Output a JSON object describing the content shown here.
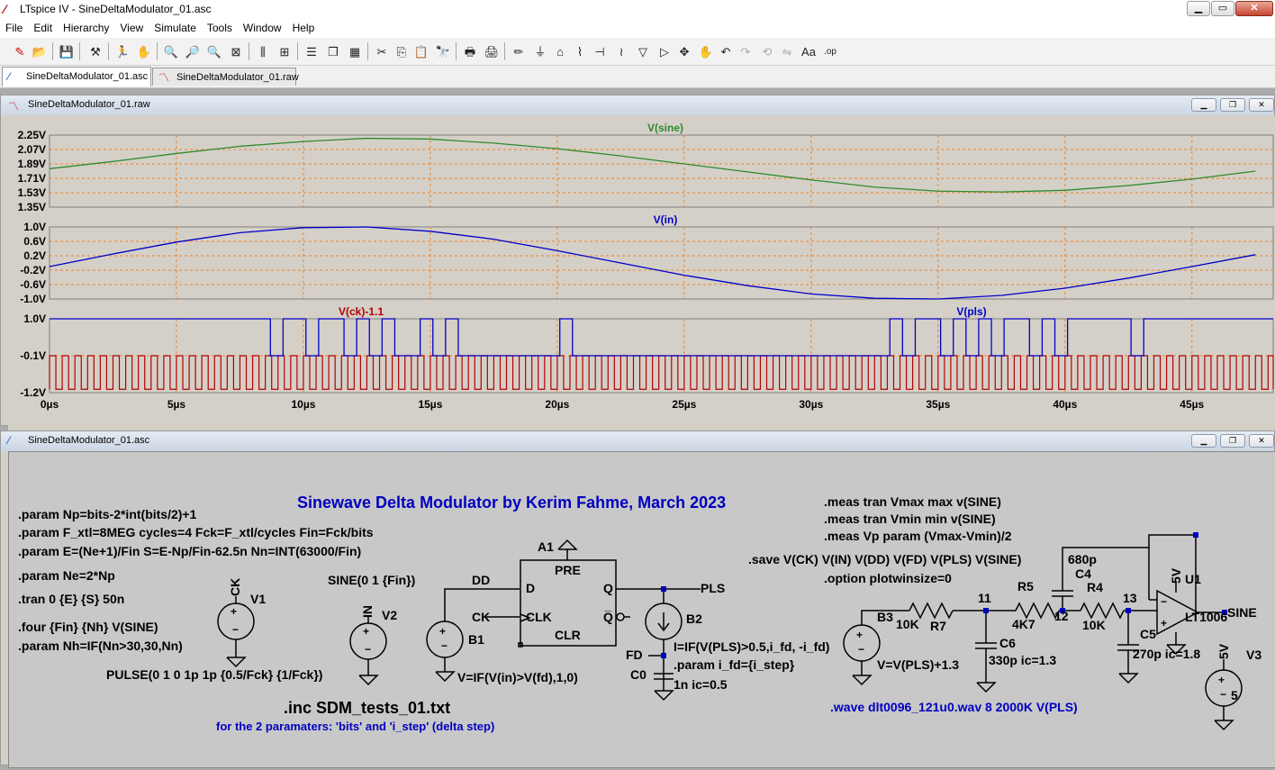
{
  "window": {
    "app_title": "LTspice IV - SineDeltaModulator_01.asc",
    "btn_min": "▁",
    "btn_max": "▭",
    "btn_close": "✕"
  },
  "menu": [
    "File",
    "Edit",
    "Hierarchy",
    "View",
    "Simulate",
    "Tools",
    "Window",
    "Help"
  ],
  "tabs": [
    {
      "label": "SineDeltaModulator_01.asc"
    },
    {
      "label": "SineDeltaModulator_01.raw"
    }
  ],
  "colors": {
    "green": "#2e8b2e",
    "blue": "#0000c8",
    "red": "#b40000",
    "grid": "#f08020"
  },
  "plot_window": {
    "title": "SineDeltaModulator_01.raw"
  },
  "schematic_window": {
    "title": "SineDeltaModulator_01.asc"
  },
  "chart_data": [
    {
      "type": "line",
      "series": [
        {
          "name": "V(sine)",
          "x": [
            0,
            2.5,
            5,
            7.5,
            10,
            12.5,
            15,
            17.5,
            20,
            22.5,
            25,
            27.5,
            30,
            32.5,
            35,
            37.5,
            40,
            42.5,
            45,
            47.5
          ],
          "values": [
            1.83,
            1.92,
            2.02,
            2.11,
            2.17,
            2.21,
            2.2,
            2.15,
            2.08,
            1.99,
            1.89,
            1.79,
            1.69,
            1.6,
            1.55,
            1.54,
            1.56,
            1.62,
            1.7,
            1.8
          ]
        }
      ],
      "yticks": [
        "2.25V",
        "2.07V",
        "1.89V",
        "1.71V",
        "1.53V",
        "1.35V"
      ],
      "ylim": [
        1.35,
        2.25
      ],
      "xlim": [
        0,
        48.2
      ]
    },
    {
      "type": "line",
      "series": [
        {
          "name": "V(in)",
          "x": [
            0,
            2.5,
            5,
            7.5,
            10,
            12.5,
            15,
            17.5,
            20,
            22.5,
            25,
            27.5,
            30,
            32.5,
            35,
            37.5,
            40,
            42.5,
            45,
            47.5
          ],
          "values": [
            -0.1,
            0.25,
            0.58,
            0.84,
            0.98,
            1.0,
            0.88,
            0.66,
            0.34,
            0.0,
            -0.34,
            -0.63,
            -0.86,
            -0.98,
            -1.0,
            -0.9,
            -0.7,
            -0.42,
            -0.1,
            0.23
          ]
        }
      ],
      "yticks": [
        "1.0V",
        "0.6V",
        "0.2V",
        "-0.2V",
        "-0.6V",
        "-1.0V"
      ],
      "ylim": [
        -1.0,
        1.0
      ],
      "xlim": [
        0,
        48.2
      ]
    },
    {
      "type": "line",
      "series": [
        {
          "name": "V(ck)-1.1",
          "period_us": 0.5,
          "high": -0.1,
          "low": -1.1
        },
        {
          "name": "V(pls)",
          "high": 1.0,
          "low": -0.1,
          "low_intervals_us": [
            [
              8.7,
              9.2
            ],
            [
              10.1,
              10.6
            ],
            [
              11.6,
              12.1
            ],
            [
              12.6,
              13.1
            ],
            [
              13.6,
              14.6
            ],
            [
              15.1,
              15.6
            ],
            [
              16.1,
              20.1
            ],
            [
              20.6,
              33.1
            ],
            [
              33.6,
              34.1
            ],
            [
              35.1,
              35.6
            ],
            [
              36.1,
              36.6
            ],
            [
              37.1,
              37.6
            ],
            [
              38.6,
              39.1
            ],
            [
              39.6,
              40.1
            ],
            [
              42.6,
              43.1
            ]
          ]
        }
      ],
      "yticks": [
        "1.0V",
        "-0.1V",
        "-1.2V"
      ],
      "ylim": [
        -1.2,
        1.0
      ],
      "xlim": [
        0,
        48.2
      ],
      "xticks": [
        "0µs",
        "5µs",
        "10µs",
        "15µs",
        "20µs",
        "25µs",
        "30µs",
        "35µs",
        "40µs",
        "45µs"
      ]
    }
  ],
  "schematic": {
    "title": "Sinewave Delta Modulator by Kerim Fahme, March 2023",
    "directives_left": [
      ".param Np=bits-2*int(bits/2)+1",
      ".param F_xtl=8MEG cycles=4 Fck=F_xtl/cycles Fin=Fck/bits",
      ".param E=(Ne+1)/Fin S=E-Np/Fin-62.5n Nn=INT(63000/Fin)",
      ".param Ne=2*Np",
      ".tran 0 {E} {S} 50n",
      ".four {Fin} {Nh} V(SINE)",
      ".param Nh=IF(Nn>30,30,Nn)"
    ],
    "pulse": "PULSE(0 1 0 1p 1p {0.5/Fck} {1/Fck})",
    "sine_src": "SINE(0 1 {Fin})",
    "inc": ".inc SDM_tests_01.txt",
    "inc_note": "for the 2 paramaters: 'bits' and 'i_step' (delta step)",
    "meas": [
      ".meas tran Vmax max v(SINE)",
      ".meas tran Vmin min v(SINE)",
      ".meas Vp param (Vmax-Vmin)/2"
    ],
    "save": ".save V(CK) V(IN) V(DD) V(FD) V(PLS) V(SINE)",
    "option": ".option plotwinsize=0",
    "wave": ".wave dlt0096_121u0.wav 8 2000K V(PLS)",
    "labels": {
      "ck": "CK",
      "v1": "V1",
      "in": "IN",
      "v2": "V2",
      "dd": "DD",
      "ck2": "CK",
      "b1": "B1",
      "b1expr": "V=IF(V(in)>V(fd),1,0)",
      "a1": "A1",
      "pre": "PRE",
      "d": "D",
      "clk": "CLK",
      "clr": "CLR",
      "q": "Q",
      "qb": "Q̅",
      "pls": "PLS",
      "b2": "B2",
      "b2expr": "I=IF(V(PLS)>0.5,i_fd, -i_fd)",
      "fd": "FD",
      "c0": "C0",
      "c0val": "1n ic=0.5",
      "ifd": ".param i_fd={i_step}",
      "b3": "B3",
      "b3expr": "V=V(PLS)+1.3",
      "r7v": "10K",
      "r7": "R7",
      "n11": "11",
      "r5": "R5",
      "r5v": "4K7",
      "n12": "12",
      "r4": "R4",
      "r4v": "10K",
      "n13": "13",
      "c6": "C6",
      "c6v": "330p ic=1.3",
      "c4v": "680p",
      "c4": "C4",
      "c5": "C5",
      "c5v": "270p ic=1.8",
      "u1": "U1",
      "u1part": "LT1006",
      "v5": "5V",
      "v5b": "5V",
      "sine": "SINE",
      "v3": "V3",
      "v3val": "5"
    }
  }
}
